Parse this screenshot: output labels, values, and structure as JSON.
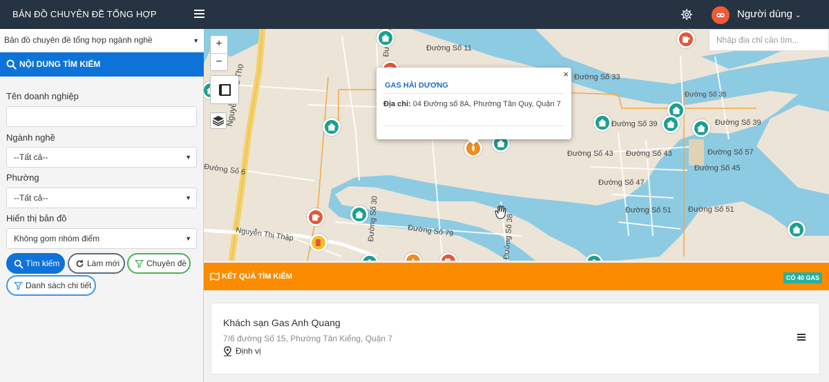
{
  "app": {
    "title": "BẢN ĐỒ CHUYÊN ĐỀ TỔNG HỢP",
    "user": "Người dùng"
  },
  "sidebar": {
    "map_select": "Bản đồ chuyên đề tổng hợp ngành nghề",
    "panel_title": "NỘI DUNG TÌM KIẾM",
    "fields": {
      "company_label": "Tên doanh nghiệp",
      "company_value": "",
      "industry_label": "Ngành nghề",
      "industry_value": "--Tất cả--",
      "ward_label": "Phường",
      "ward_value": "--Tất cả--",
      "display_label": "Hiển thị bản đồ",
      "display_value": "Không gom nhóm điểm"
    },
    "buttons": {
      "search": "Tìm kiếm",
      "reset": "Làm mới",
      "topic": "Chuyên đề",
      "detail_list": "Danh sách chi tiết"
    }
  },
  "map": {
    "search_placeholder": "Nhập địa chỉ cần tìm...",
    "zoom_in": "+",
    "zoom_out": "−",
    "popup": {
      "title": "GAS HẢI DƯƠNG",
      "address_label": "Địa chỉ:",
      "address_value": "04 Đường số 8A, Phường Tân Quy, Quận 7",
      "close": "×"
    },
    "street_labels": [
      "Đường Số 11",
      "Đường Số 33",
      "Đường Số 35",
      "Đường Số 39",
      "Đường Số 39",
      "Đường Số 43",
      "Đường Số 43",
      "Đường Số 57",
      "Đường Số 45",
      "Đường Số 47",
      "Đường Số 51",
      "Đường Số 51",
      "Đường Số 79",
      "Nguyễn Hữu Thọ",
      "Nguyễn Thị Thập",
      "Đường Số 30",
      "Đường Số 38",
      "Đường Số 6",
      "Đường Số 8"
    ]
  },
  "results": {
    "title": "KẾT QUẢ TÌM KIẾM",
    "badge": "CÓ 40 GAS",
    "items": [
      {
        "name": "Khách sạn Gas Anh Quang",
        "address": "7/6 đường Số 15, Phường Tân Kiểng, Quận 7",
        "locate": "Định vị"
      }
    ]
  },
  "colors": {
    "topbar": "#253342",
    "primary": "#0e73d8",
    "results_header": "#fb8c00",
    "badge": "#27b0a0",
    "marker_house": "#19a08f",
    "marker_gas": "#e8563a",
    "water": "#8dcbe2",
    "road_major": "#f3d36b"
  },
  "icons": [
    "menu-icon",
    "gear-icon",
    "avatar-icon",
    "search-icon",
    "refresh-icon",
    "filter-icon",
    "layers-icon",
    "fullscreen-icon",
    "map-pin-icon",
    "house-icon",
    "gas-icon",
    "hand-cursor-icon"
  ]
}
